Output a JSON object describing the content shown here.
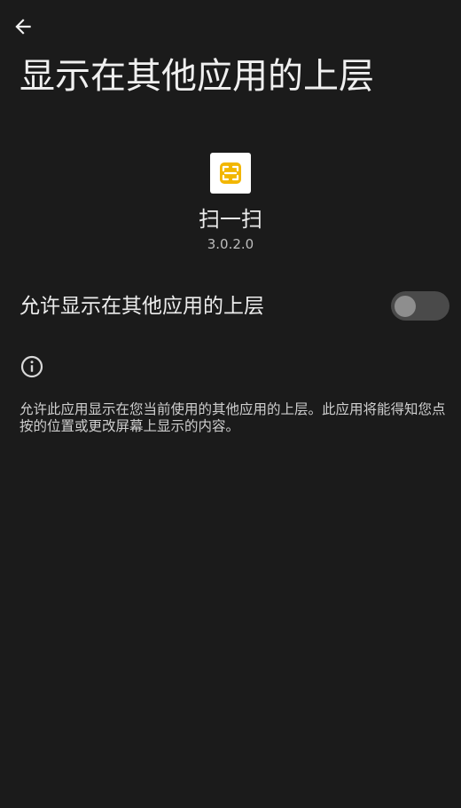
{
  "header": {
    "back_icon": "arrow-left-icon",
    "title": "显示在其他应用的上层"
  },
  "app": {
    "icon": "scan-frame-icon",
    "icon_color": "#f2b600",
    "name": "扫一扫",
    "version": "3.0.2.0"
  },
  "setting": {
    "label": "允许显示在其他应用的上层",
    "toggle_state": "off"
  },
  "info": {
    "icon": "info-icon",
    "description": "允许此应用显示在您当前使用的其他应用的上层。此应用将能得知您点按的位置或更改屏幕上显示的内容。"
  },
  "colors": {
    "background": "#1b1b1b",
    "toggle_track": "#4a4a4a",
    "toggle_thumb": "#8e8e8e"
  }
}
